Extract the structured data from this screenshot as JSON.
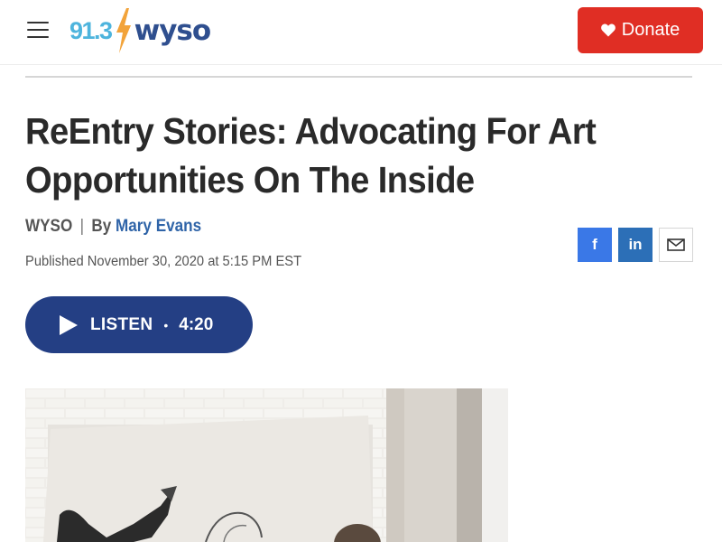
{
  "header": {
    "menu_icon": "hamburger-menu-icon",
    "logo": {
      "frequency": "91.3",
      "callsign": "wyso",
      "bolt_icon": "lightning-bolt-icon"
    },
    "donate": {
      "label": "Donate",
      "icon": "heart-icon"
    }
  },
  "article": {
    "title": "ReEntry Stories: Advocating For Art Opportunities On The Inside",
    "source": "WYSO",
    "separator": "|",
    "by_prefix": "By",
    "author": "Mary Evans",
    "published": "Published November 30, 2020 at 5:15 PM EST"
  },
  "share": {
    "facebook": {
      "label": "f",
      "icon": "facebook-icon"
    },
    "linkedin": {
      "label": "in",
      "icon": "linkedin-icon"
    },
    "email": {
      "icon": "email-icon"
    }
  },
  "audio": {
    "label": "LISTEN",
    "bullet": "•",
    "duration": "4:20",
    "icon": "play-icon"
  },
  "colors": {
    "brand_blue": "#2f4f8f",
    "brand_light_blue": "#4db4dd",
    "bolt_orange": "#f2a33a",
    "donate_red": "#e02e24",
    "listen_blue": "#243f84",
    "author_link": "#2f64a8",
    "facebook": "#3a78e7",
    "linkedin": "#2c6fb7"
  }
}
